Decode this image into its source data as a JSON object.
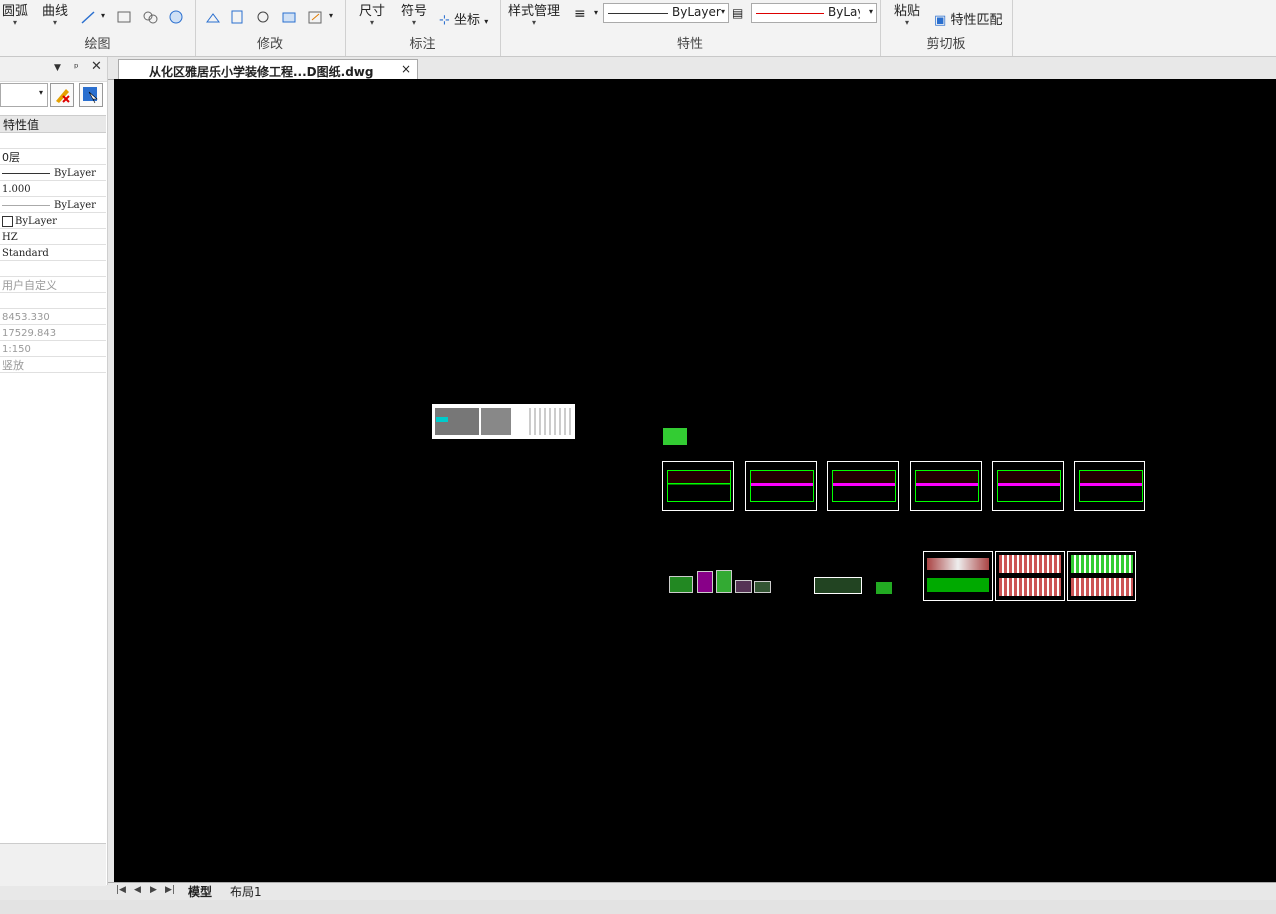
{
  "ribbon": {
    "draw": {
      "arc_label": "圆弧",
      "curve_label": "曲线",
      "group_label": "绘图"
    },
    "modify": {
      "group_label": "修改"
    },
    "annotate": {
      "dimension_label": "尺寸",
      "symbol_label": "符号",
      "coordinate_label": "坐标",
      "group_label": "标注"
    },
    "properties": {
      "style_manager_label": "样式管理",
      "linetype_value": "ByLayer",
      "color_value": "ByLay\u0000",
      "group_label": "特性"
    },
    "clipboard": {
      "paste_label": "粘贴",
      "match_props_label": "特性匹配",
      "group_label": "剪切板"
    }
  },
  "panel": {
    "header_label": "特性值",
    "rows": [
      {
        "value": ""
      },
      {
        "value": "0层"
      },
      {
        "value": "ByLayer"
      },
      {
        "value": "1.000"
      },
      {
        "value": "ByLayer"
      },
      {
        "value": "ByLayer"
      },
      {
        "value": "HZ"
      },
      {
        "value": "Standard"
      },
      {
        "value": ""
      },
      {
        "value": "用户自定义"
      },
      {
        "value": ""
      },
      {
        "value": "8453.330"
      },
      {
        "value": "17529.843"
      },
      {
        "value": "1:150"
      },
      {
        "value": "竖放"
      }
    ]
  },
  "document": {
    "tab_title": "从化区雅居乐小学装修工程...D图纸.dwg",
    "close_glyph": "×"
  },
  "layout_tabs": {
    "model": "模型",
    "layout1": "布局1"
  },
  "icons": [
    "dropdown-icon",
    "pin-icon",
    "close-icon",
    "select-objects-icon",
    "clear-selection-icon"
  ]
}
